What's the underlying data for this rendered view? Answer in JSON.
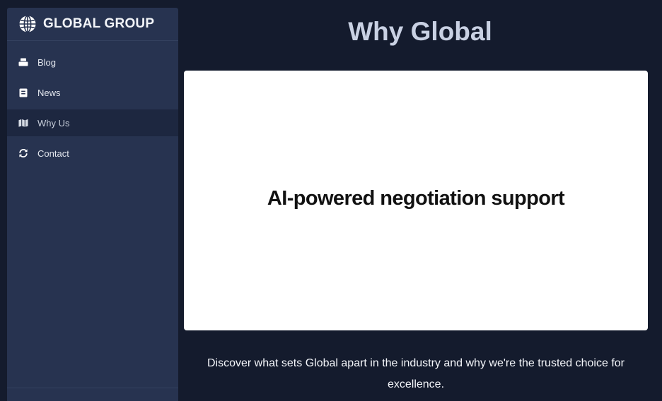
{
  "brand": {
    "title": "GLOBAL GROUP",
    "icon": "globe-icon"
  },
  "nav": {
    "items": [
      {
        "label": "Blog",
        "icon": "inbox-tray-icon",
        "active": false
      },
      {
        "label": "News",
        "icon": "newspaper-icon",
        "active": false
      },
      {
        "label": "Why Us",
        "icon": "map-icon",
        "active": true
      },
      {
        "label": "Contact",
        "icon": "refresh-icon",
        "active": false
      }
    ]
  },
  "main": {
    "title": "Why Global",
    "feature": "AI-powered negotiation support",
    "description": "Discover what sets Global apart in the industry and why we're the trusted choice for excellence."
  },
  "colors": {
    "background": "#141b2d",
    "sidebar": "#273350",
    "sidebar_active": "#1d2740",
    "title": "#c9d1e3",
    "card": "#ffffff"
  }
}
